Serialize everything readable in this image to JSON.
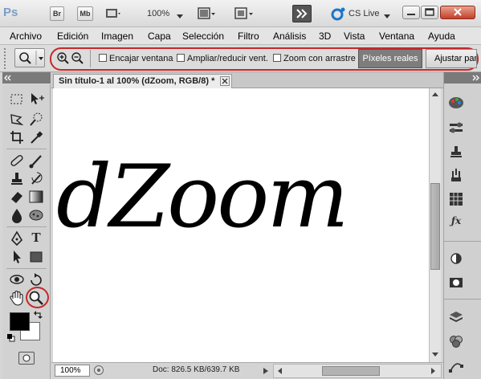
{
  "titlebar": {
    "app_logo": "Ps",
    "bridge_btn": "Br",
    "minibridge_btn": "Mb",
    "zoom_level": "100%",
    "cslive_label": "CS Live",
    "icons": [
      "film-icon",
      "layout-icon",
      "screen-mode-icon",
      "extend-icon",
      "cslive-icon"
    ]
  },
  "menubar": {
    "items": [
      "Archivo",
      "Edición",
      "Imagen",
      "Capa",
      "Selección",
      "Filtro",
      "Análisis",
      "3D",
      "Vista",
      "Ventana",
      "Ayuda"
    ]
  },
  "options": {
    "fit_window": "Encajar ventana",
    "resize_windows": "Ampliar/reducir vent.",
    "scrubby_zoom": "Zoom con arrastre",
    "actual_pixels": "Píxeles reales",
    "fit_screen": "Ajustar pan"
  },
  "document": {
    "tab_title": "Sin título-1 al 100% (dZoom, RGB/8) *",
    "canvas_text": "dZoom",
    "zoom_field": "100%",
    "doc_info": "Doc: 826.5 KB/639.7 KB"
  },
  "colors": {
    "highlight": "#c62828",
    "foreground": "#000000",
    "background": "#ffffff"
  }
}
